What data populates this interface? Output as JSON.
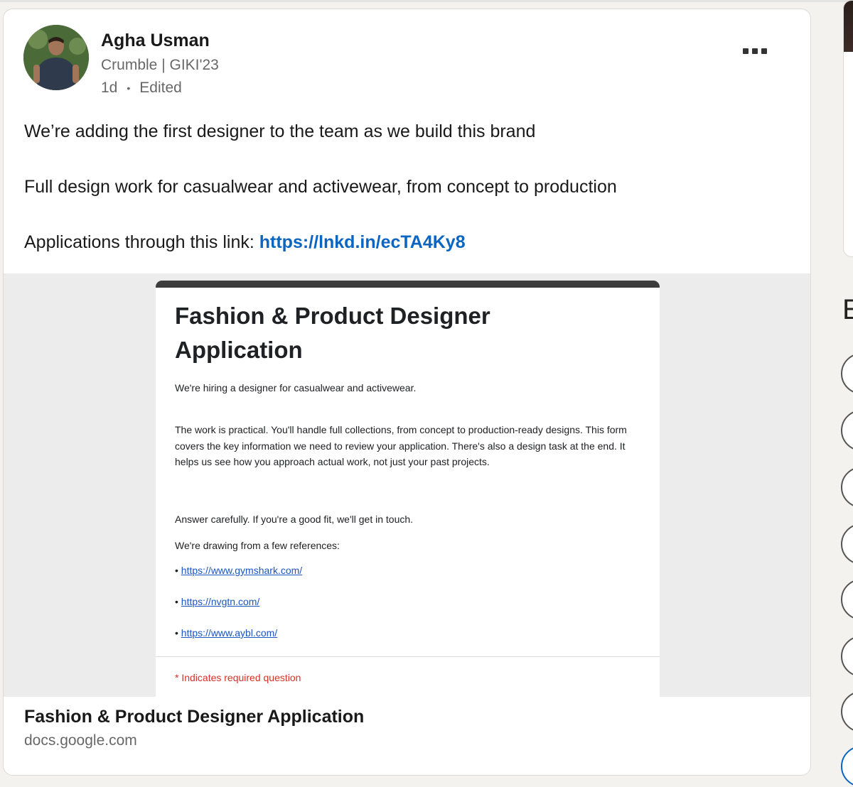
{
  "post": {
    "author": {
      "name": "Agha Usman",
      "headline": "Crumble | GIKI'23",
      "time": "1d",
      "edited": "Edited"
    },
    "paragraphs": [
      "We’re adding the first designer to the team as we build this brand",
      "Full design work for casualwear and activewear, from concept to production",
      "Applications through this link:"
    ],
    "link_text": "https://lnkd.in/ecTA4Ky8"
  },
  "preview": {
    "title": "Fashion & Product Designer Application",
    "intro": "We're hiring a designer for casualwear and activewear.",
    "body": "The work is practical. You'll handle full collections, from concept to production-ready designs. This form covers the key information we need to review your application. There's also a design task at the end. It helps us see how you approach actual work, not just your past projects.",
    "note": "Answer carefully. If you're a good fit, we'll get in touch.",
    "refs_label": "We're drawing from a few references:",
    "references": [
      "https://www.gymshark.com/",
      "https://nvgtn.com/",
      "https://www.aybl.com/"
    ],
    "required": "* Indicates required question"
  },
  "link_card": {
    "title": "Fashion & Product Designer Application",
    "domain": "docs.google.com"
  },
  "right_rail": {
    "heading_letter": "E"
  },
  "colors": {
    "link": "#0a66c2",
    "required": "#d93025"
  }
}
